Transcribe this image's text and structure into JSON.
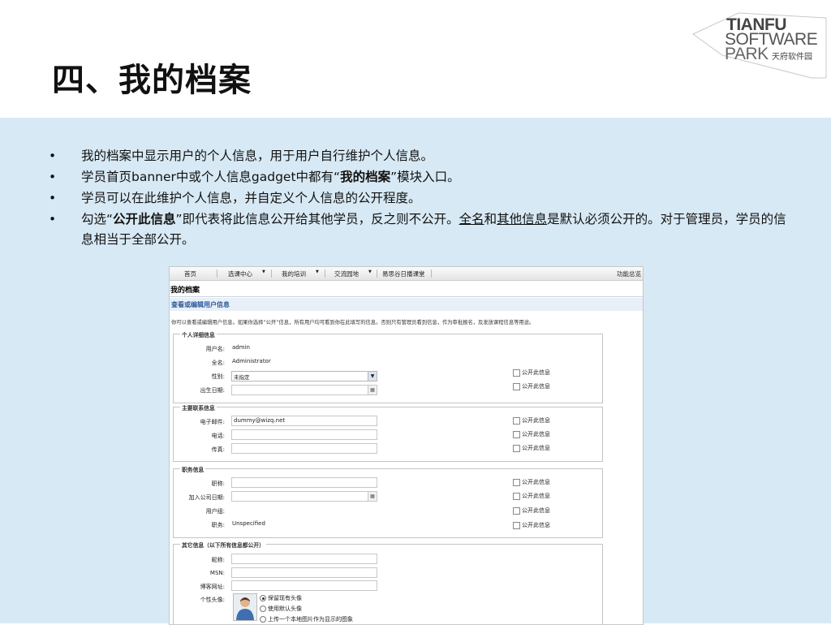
{
  "slide": {
    "title": "四、我的档案",
    "logo": {
      "line1": "TIANFU",
      "line2": "SOFTWARE",
      "line3": "PARK",
      "cn": "天府软件园"
    },
    "bullets": [
      {
        "text": "我的档案中显示用户的个人信息，用于用户自行维护个人信息。"
      },
      {
        "pre": "学员首页banner中或个人信息gadget中都有“",
        "bold": "我的档案",
        "post": "”模块入口。"
      },
      {
        "text": "学员可以在此维护个人信息，并自定义个人信息的公开程度。"
      },
      {
        "pre": "勾选“",
        "bold": "公开此信息",
        "mid": "”即代表将此信息公开给其他学员，反之则不公开。",
        "u1": "全名",
        "and": "和",
        "u2": "其他信息",
        "post": "是默认必须公开的。对于管理员，学员的信息相当于全部公开。"
      }
    ],
    "bullet_glyph": "•"
  },
  "shot": {
    "nav": [
      "首页",
      "选课中心",
      "我的培训",
      "交流园地",
      "易思谷日播课堂",
      "功能总览"
    ],
    "nav_arrow": "▼",
    "heading": "我的档案",
    "subheading": "查看或编辑用户信息",
    "intro": "你可以查看或编辑用户信息。如果你选择“公开”信息，所有用户均可看到你在此填写的信息。否则只有管理员看到信息，作为审批报名，及发放课程信息等用途。",
    "public_label": "公开此信息",
    "sections": {
      "personal": {
        "legend": "个人详细信息",
        "username_label": "用户名:",
        "username": "admin",
        "fullname_label": "全名:",
        "fullname": "Administrator",
        "gender_label": "性别:",
        "gender": "未指定",
        "birth_label": "出生日期:"
      },
      "contact": {
        "legend": "主要联系信息",
        "email_label": "电子邮件:",
        "email": "dummy@wizq.net",
        "phone_label": "电话:",
        "fax_label": "传真:"
      },
      "job": {
        "legend": "职务信息",
        "title_label": "职称:",
        "join_label": "加入公司日期:",
        "group_label": "用户组:",
        "role_label": "职务:",
        "role": "Unspecified"
      },
      "other": {
        "legend": "其它信息（以下所有信息都公开）",
        "nick_label": "昵称:",
        "msn_label": "MSN:",
        "blog_label": "博客网址:",
        "avatar_label": "个性头像:",
        "avatar_options": [
          "保留现有头像",
          "使用默认头像",
          "上传一个本地图片作为显示的图象"
        ]
      }
    }
  }
}
